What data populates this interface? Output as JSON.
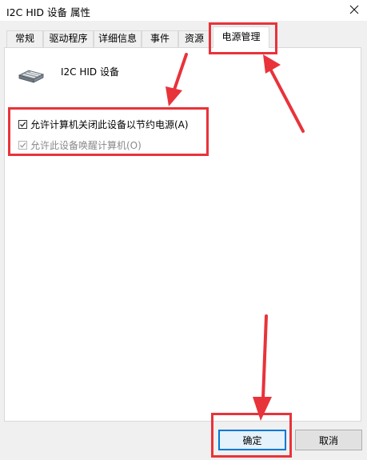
{
  "window": {
    "title": "I2C HID 设备 属性"
  },
  "tabs": [
    {
      "label": "常规",
      "selected": false
    },
    {
      "label": "驱动程序",
      "selected": false
    },
    {
      "label": "详细信息",
      "selected": false
    },
    {
      "label": "事件",
      "selected": false
    },
    {
      "label": "资源",
      "selected": false
    },
    {
      "label": "电源管理",
      "selected": true
    }
  ],
  "device": {
    "name": "I2C HID 设备",
    "icon": "hid-device-icon"
  },
  "power_options": [
    {
      "label": "允许计算机关闭此设备以节约电源(A)",
      "checked": true,
      "enabled": true
    },
    {
      "label": "允许此设备唤醒计算机(O)",
      "checked": true,
      "enabled": false
    }
  ],
  "buttons": {
    "ok_label": "确定",
    "cancel_label": "取消"
  },
  "colors": {
    "annotation": "#e8333a",
    "default_button_border": "#0078d7",
    "panel_background": "#ffffff",
    "window_background": "#f0f0f0"
  }
}
